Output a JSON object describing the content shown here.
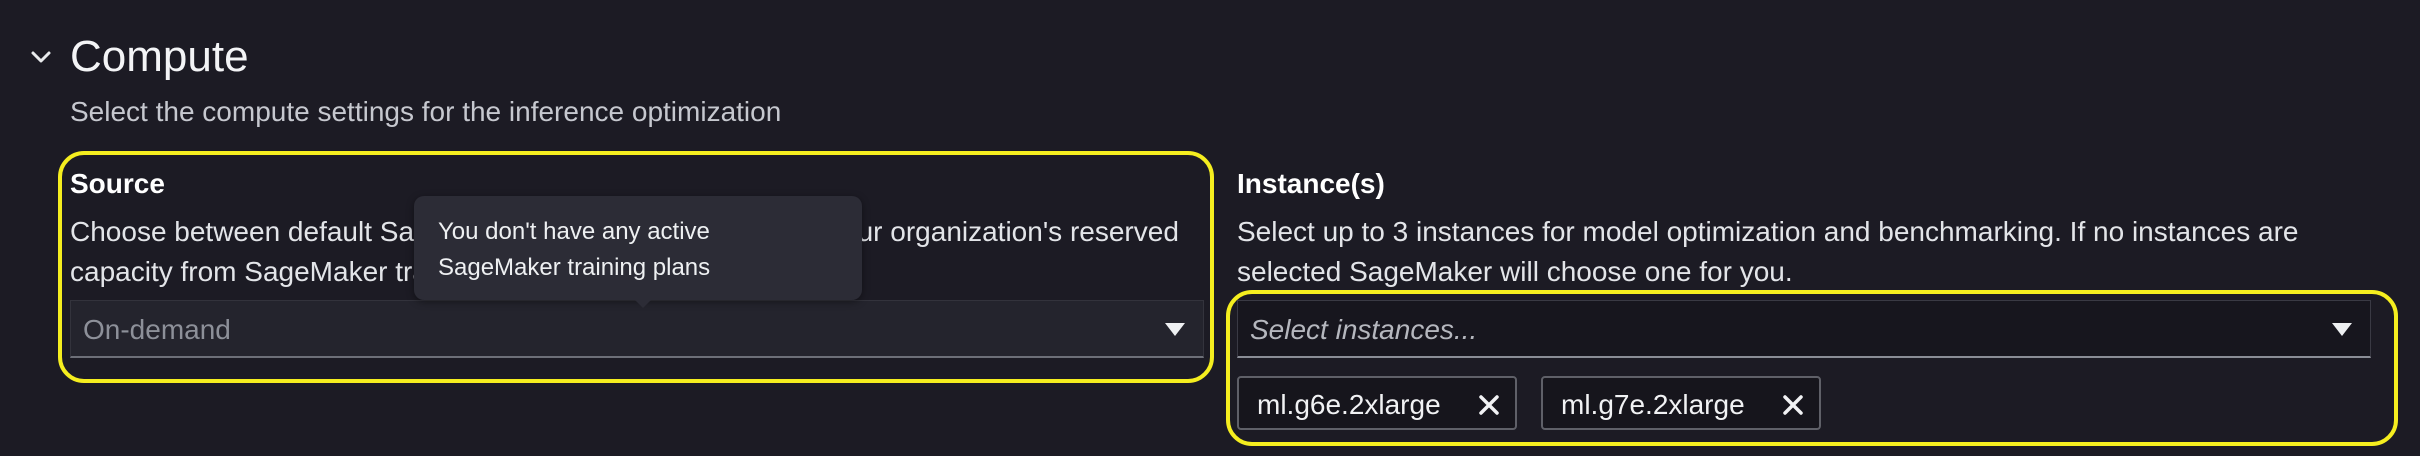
{
  "section": {
    "title": "Compute",
    "subtitle": "Select the compute settings for the inference optimization",
    "toggle_icon": "chevron-down-icon"
  },
  "source": {
    "label": "Source",
    "description": "Choose between default SageMaker on-demand compute or your organization's reserved capacity from SageMaker training plans",
    "selected_value": "On-demand",
    "tooltip": "You don't have any active SageMaker training plans"
  },
  "instances": {
    "label": "Instance(s)",
    "description": "Select up to 3 instances for model optimization and benchmarking. If no instances are selected SageMaker will choose one for you.",
    "placeholder": "Select instances...",
    "tokens": [
      {
        "name": "ml.g6e.2xlarge"
      },
      {
        "name": "ml.g7e.2xlarge"
      }
    ]
  },
  "colors": {
    "background": "#1c1b24",
    "highlight": "#f5ee1f",
    "text": "#e9ebed"
  }
}
